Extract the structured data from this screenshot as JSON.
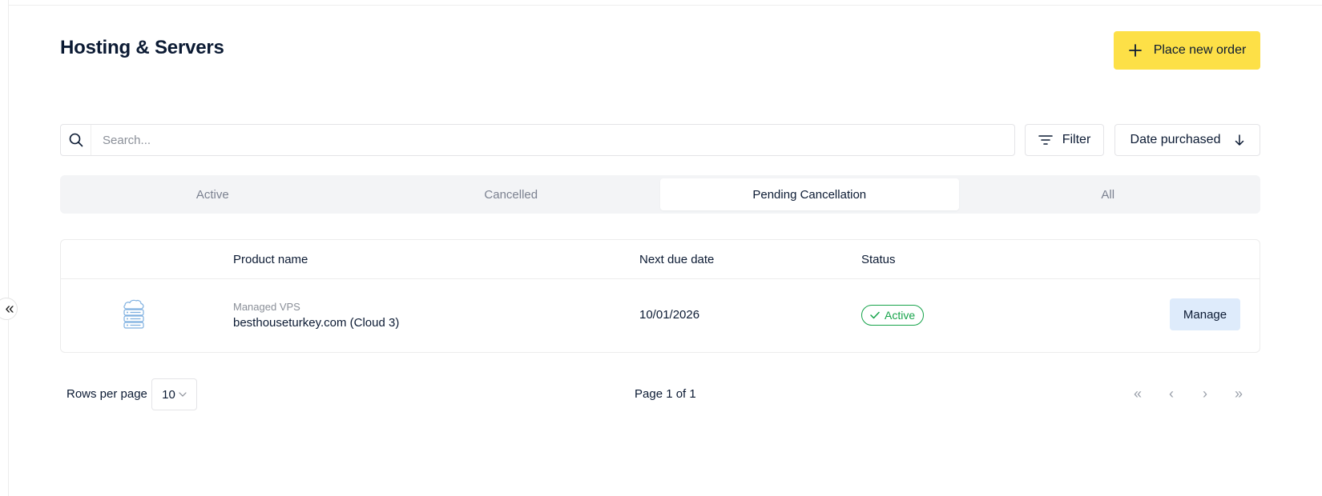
{
  "page": {
    "title": "Hosting & Servers"
  },
  "header": {
    "place_order_label": "Place new order"
  },
  "toolbar": {
    "search_placeholder": "Search...",
    "filter_label": "Filter",
    "sort_label": "Date purchased"
  },
  "tabs": [
    {
      "label": "Active",
      "selected": false
    },
    {
      "label": "Cancelled",
      "selected": false
    },
    {
      "label": "Pending Cancellation",
      "selected": true
    },
    {
      "label": "All",
      "selected": false
    }
  ],
  "table": {
    "columns": [
      "Product name",
      "Next due date",
      "Status"
    ],
    "rows": [
      {
        "icon": "cloud-server-icon",
        "product_type": "Managed VPS",
        "product_name": "besthouseturkey.com (Cloud 3)",
        "next_due_date": "10/01/2026",
        "status": "Active",
        "action_label": "Manage"
      }
    ]
  },
  "pagination": {
    "rows_per_page_label": "Rows per page",
    "rows_per_page_value": "10",
    "page_info": "Page 1 of 1"
  },
  "colors": {
    "accent_yellow": "#fde047",
    "status_green": "#16a34a",
    "manage_bg": "#deebfb",
    "icon_blue": "#7fb0e0"
  }
}
